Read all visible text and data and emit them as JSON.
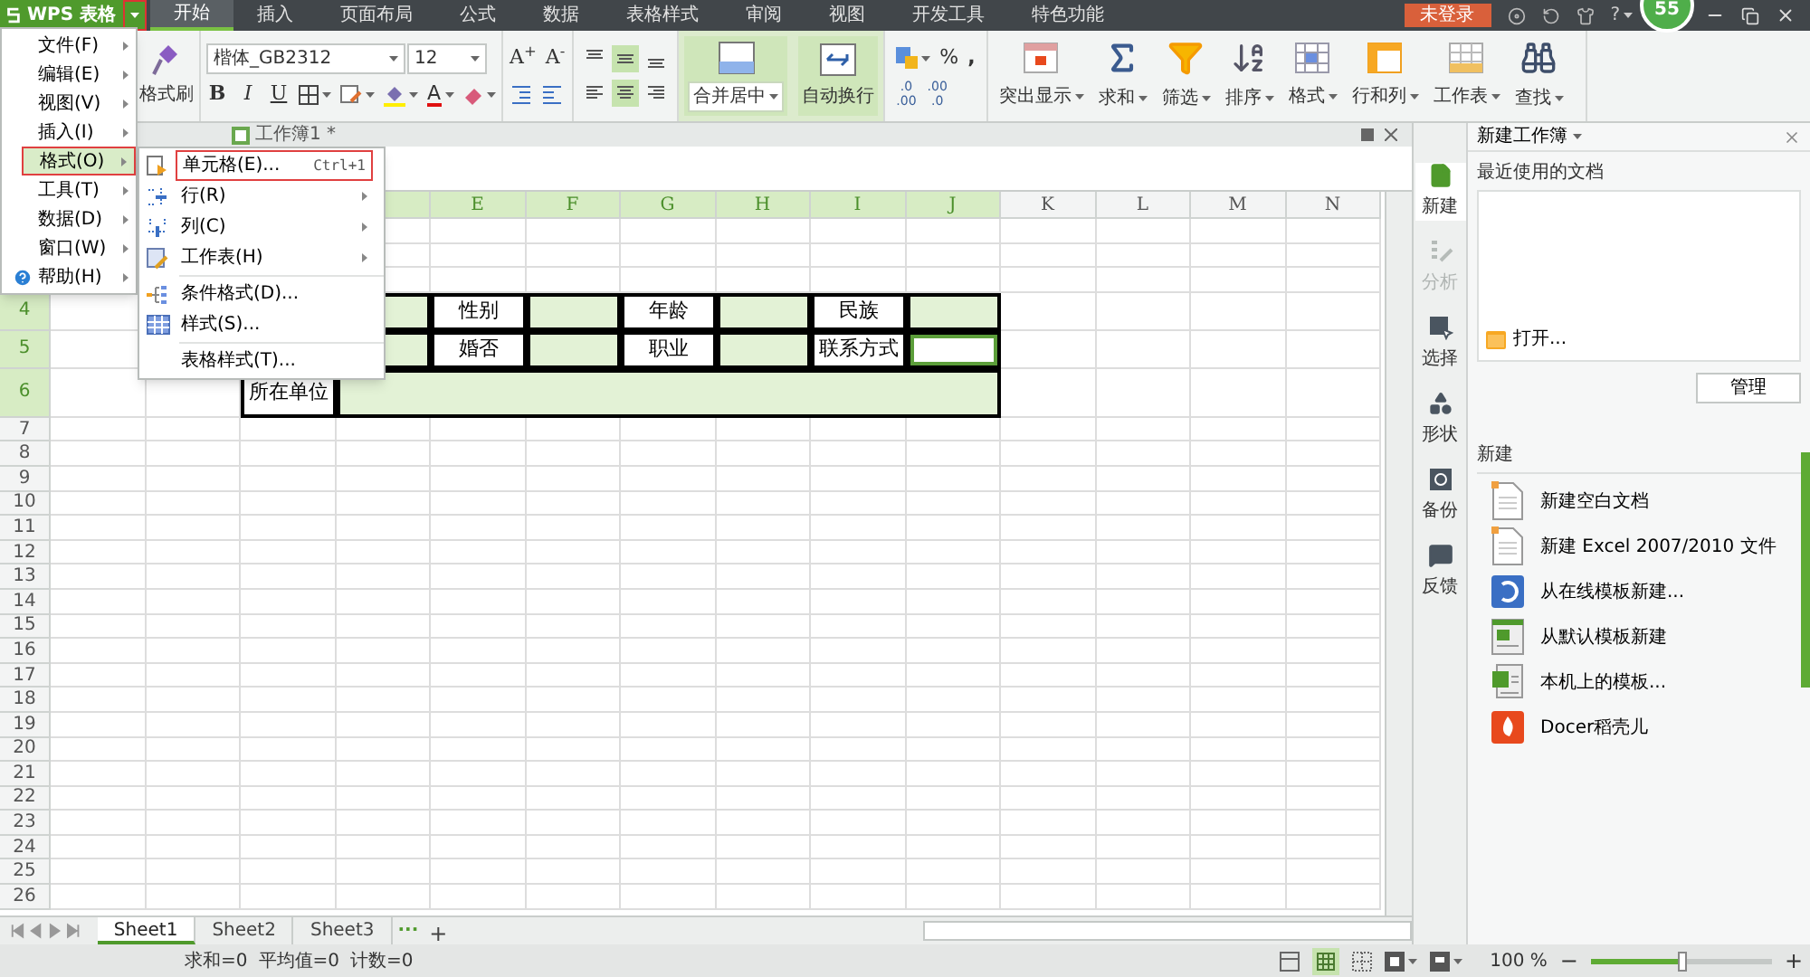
{
  "app": {
    "title": "WPS 表格"
  },
  "menu_tabs": [
    {
      "label": "开始",
      "selected": true
    },
    {
      "label": "插入",
      "selected": false
    },
    {
      "label": "页面布局",
      "selected": false
    },
    {
      "label": "公式",
      "selected": false
    },
    {
      "label": "数据",
      "selected": false
    },
    {
      "label": "表格样式",
      "selected": false
    },
    {
      "label": "审阅",
      "selected": false
    },
    {
      "label": "视图",
      "selected": false
    },
    {
      "label": "开发工具",
      "selected": false
    },
    {
      "label": "特色功能",
      "selected": false
    }
  ],
  "login_button": "未登录",
  "help": "?",
  "badge": "55",
  "ribbon": {
    "format_painter": "格式刷",
    "font": "楷体_GB2312",
    "font_size": "12",
    "bold": "B",
    "italic": "I",
    "underline": "U",
    "font_color": "A",
    "grow_font": "A$^{+}$",
    "shrink_font": "A$^{-}$",
    "vertical_align": [
      {
        "selected": false
      },
      {
        "selected": true
      },
      {
        "selected": false
      }
    ],
    "horizontal_align": [
      {
        "selected": false
      },
      {
        "selected": true
      },
      {
        "selected": false
      }
    ],
    "merge_button": {
      "label": "合并居中",
      "selected": true
    },
    "wrap_button": {
      "label": "自动换行",
      "selected": true
    },
    "percent": "%",
    "comma": ",",
    "decimal_buttons": [
      ".0\n.00",
      ".00\n.0"
    ],
    "buttons": [
      {
        "label": "突出显示"
      },
      {
        "label": "求和"
      },
      {
        "label": "筛选"
      },
      {
        "label": "排序"
      },
      {
        "label": "格式"
      },
      {
        "label": "行和列"
      },
      {
        "label": "工作表"
      },
      {
        "label": "查找"
      }
    ]
  },
  "doc_tab": "工作簿1 *",
  "main_menu": [
    {
      "label": "文件(F)",
      "kind": "submenu",
      "selected": false
    },
    {
      "label": "编辑(E)",
      "kind": "submenu",
      "selected": false
    },
    {
      "label": "视图(V)",
      "kind": "submenu",
      "selected": false
    },
    {
      "label": "插入(I)",
      "kind": "submenu",
      "selected": false
    },
    {
      "label": "格式(O)",
      "kind": "submenu",
      "selected": true
    },
    {
      "label": "工具(T)",
      "kind": "submenu",
      "selected": false
    },
    {
      "label": "数据(D)",
      "kind": "submenu",
      "selected": false
    },
    {
      "label": "窗口(W)",
      "kind": "submenu",
      "selected": false
    },
    {
      "label": "帮助(H)",
      "kind": "help",
      "selected": false
    }
  ],
  "format_menu": [
    {
      "label": "单元格(E)...",
      "shortcut": "Ctrl+1",
      "kind": "item",
      "selected": true
    },
    {
      "label": "行(R)",
      "kind": "submenu",
      "selected": false
    },
    {
      "label": "列(C)",
      "kind": "submenu",
      "selected": false
    },
    {
      "label": "工作表(H)",
      "kind": "submenu",
      "selected": false
    },
    {
      "kind": "separator"
    },
    {
      "label": "条件格式(D)...",
      "kind": "item",
      "selected": false
    },
    {
      "label": "样式(S)...",
      "kind": "item",
      "selected": false
    },
    {
      "kind": "separator"
    },
    {
      "label": "表格样式(T)...",
      "kind": "item",
      "selected": false
    }
  ],
  "columns": [
    {
      "selected": true
    },
    {
      "label": "E",
      "selected": true
    },
    {
      "label": "F",
      "selected": true
    },
    {
      "label": "G",
      "selected": true
    },
    {
      "label": "H",
      "selected": true
    },
    {
      "label": "I",
      "selected": true
    },
    {
      "label": "J",
      "selected": true
    },
    {
      "label": "K",
      "selected": false
    },
    {
      "label": "L",
      "selected": false
    },
    {
      "label": "M",
      "selected": false
    },
    {
      "label": "N",
      "selected": false
    }
  ],
  "rows": [
    {
      "label": "4",
      "selected": true,
      "cells": [
        {
          "kind": "input"
        },
        {
          "kind": "label",
          "text": "性别"
        },
        {
          "kind": "input"
        },
        {
          "kind": "label",
          "text": "年龄"
        },
        {
          "kind": "input"
        },
        {
          "kind": "label",
          "text": "民族"
        },
        {
          "kind": "input"
        }
      ]
    },
    {
      "label": "5",
      "selected": true,
      "cells": [
        {
          "kind": "input"
        },
        {
          "kind": "label",
          "text": "婚否"
        },
        {
          "kind": "input"
        },
        {
          "kind": "label",
          "text": "职业"
        },
        {
          "kind": "input"
        },
        {
          "kind": "label",
          "text": "联系方式"
        },
        {
          "kind": "current"
        }
      ]
    },
    {
      "label": "6",
      "selected": true,
      "cells": [
        {
          "kind": "label",
          "text": "所在单位"
        },
        {
          "kind": "merged"
        }
      ]
    },
    {
      "label": "7",
      "selected": false
    },
    {
      "label": "8",
      "selected": false
    },
    {
      "label": "9",
      "selected": false
    },
    {
      "label": "10",
      "selected": false
    },
    {
      "label": "11",
      "selected": false
    },
    {
      "label": "12",
      "selected": false
    },
    {
      "label": "13",
      "selected": false
    },
    {
      "label": "14",
      "selected": false
    },
    {
      "label": "15",
      "selected": false
    },
    {
      "label": "16",
      "selected": false
    },
    {
      "label": "17",
      "selected": false
    },
    {
      "label": "18",
      "selected": false
    },
    {
      "label": "19",
      "selected": false
    },
    {
      "label": "20",
      "selected": false
    },
    {
      "label": "21",
      "selected": false
    },
    {
      "label": "22",
      "selected": false
    },
    {
      "label": "23",
      "selected": false
    },
    {
      "label": "24",
      "selected": false
    },
    {
      "label": "25",
      "selected": false
    },
    {
      "label": "26",
      "selected": false
    }
  ],
  "sheet_tabs": [
    {
      "label": "Sheet1",
      "selected": true
    },
    {
      "label": "Sheet2",
      "selected": false
    },
    {
      "label": "Sheet3",
      "selected": false
    }
  ],
  "more_sheets": "···",
  "add_sheet": "+",
  "status": {
    "sum": "求和=0",
    "average": "平均值=0",
    "count": "计数=0"
  },
  "zoom": {
    "reading": "100 %",
    "minus": "−",
    "plus": "+",
    "level": 0.5
  },
  "task_sidebar": [
    {
      "label": "新建",
      "selected": true,
      "disabled": false
    },
    {
      "label": "分析",
      "selected": false,
      "disabled": true
    },
    {
      "label": "选择",
      "selected": false,
      "disabled": false
    },
    {
      "label": "形状",
      "selected": false,
      "disabled": false
    },
    {
      "label": "备份",
      "selected": false,
      "disabled": false
    },
    {
      "label": "反馈",
      "selected": false,
      "disabled": false
    }
  ],
  "task_panel": {
    "title": "新建工作簿",
    "recent_heading": "最近使用的文档",
    "open_link": "打开...",
    "manage_button": "管理",
    "new_heading": "新建",
    "new_items": [
      {
        "label": "新建空白文档"
      },
      {
        "label": "新建 Excel 2007/2010 文件"
      },
      {
        "label": "从在线模板新建..."
      },
      {
        "label": "从默认模板新建"
      },
      {
        "label": "本机上的模板..."
      },
      {
        "label": "Docer稻壳儿"
      }
    ]
  }
}
